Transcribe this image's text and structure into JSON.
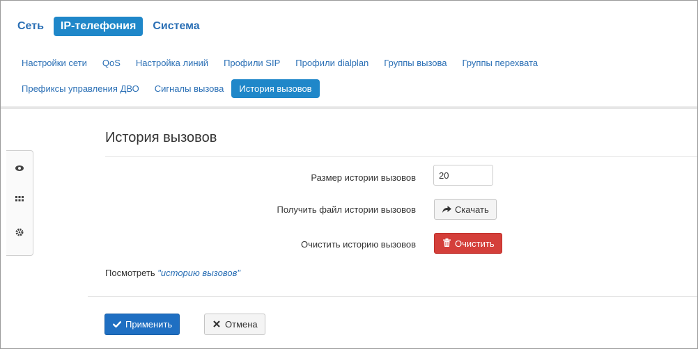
{
  "top_nav": {
    "items": [
      {
        "label": "Сеть",
        "active": false
      },
      {
        "label": "IP-телефония",
        "active": true
      },
      {
        "label": "Система",
        "active": false
      }
    ]
  },
  "sub_nav": {
    "row1": [
      {
        "label": "Настройки сети"
      },
      {
        "label": "QoS"
      },
      {
        "label": "Настройка линий"
      },
      {
        "label": "Профили SIP"
      },
      {
        "label": "Профили dialplan"
      },
      {
        "label": "Группы вызова"
      },
      {
        "label": "Группы перехвата"
      }
    ],
    "row2": [
      {
        "label": "Префиксы управления ДВО"
      },
      {
        "label": "Сигналы вызова"
      },
      {
        "label": "История вызовов",
        "active": true
      }
    ]
  },
  "sidebar": {
    "icons": [
      "eye-icon",
      "grid-icon",
      "gear-icon"
    ]
  },
  "section": {
    "title": "История вызовов"
  },
  "form": {
    "history_size_label": "Размер истории вызовов",
    "history_size_value": "20",
    "download_label": "Получить файл истории вызовов",
    "download_button": "Скачать",
    "clear_label": "Очистить историю вызовов",
    "clear_button": "Очистить",
    "view_prefix": "Посмотреть",
    "view_link": "\"историю вызовов\""
  },
  "footer": {
    "apply_button": "Применить",
    "cancel_button": "Отмена"
  },
  "colors": {
    "accent": "#1f87c9",
    "primary_button": "#1f6fc2",
    "danger_button": "#d43f3a",
    "link": "#2a6fb5"
  }
}
